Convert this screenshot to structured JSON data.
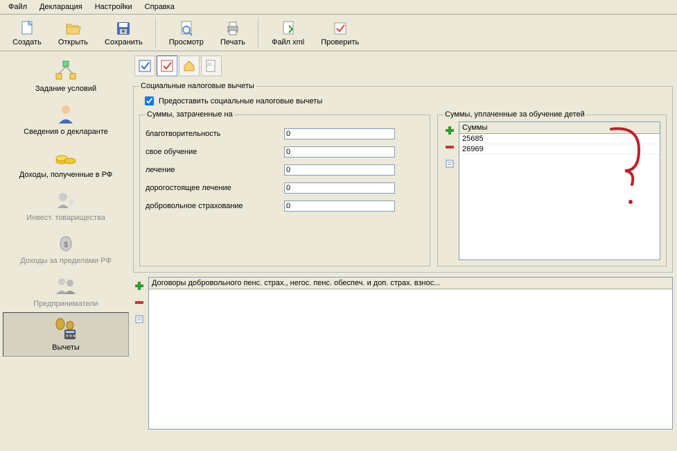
{
  "menubar": [
    "Файл",
    "Декларация",
    "Настройки",
    "Справка"
  ],
  "toolbar": [
    {
      "label": "Создать",
      "icon": "new"
    },
    {
      "label": "Открыть",
      "icon": "open"
    },
    {
      "label": "Сохранить",
      "icon": "save"
    },
    {
      "sep": true
    },
    {
      "label": "Просмотр",
      "icon": "preview"
    },
    {
      "label": "Печать",
      "icon": "print"
    },
    {
      "sep": true
    },
    {
      "label": "Файл xml",
      "icon": "xml"
    },
    {
      "label": "Проверить",
      "icon": "check"
    }
  ],
  "sidebar": [
    {
      "label": "Задание условий",
      "icon": "conditions",
      "enabled": true
    },
    {
      "label": "Сведения о декларанте",
      "icon": "declarant",
      "enabled": true
    },
    {
      "label": "Доходы, полученные в РФ",
      "icon": "income-rf",
      "enabled": true
    },
    {
      "label": "Инвест. товарищества",
      "icon": "invest",
      "enabled": false
    },
    {
      "label": "Доходы за пределами РФ",
      "icon": "income-abroad",
      "enabled": false
    },
    {
      "label": "Предприниматели",
      "icon": "entrepreneurs",
      "enabled": false
    },
    {
      "label": "Вычеты",
      "icon": "deductions",
      "enabled": true,
      "active": true
    }
  ],
  "section": {
    "title": "Социальные налоговые вычеты",
    "checkbox_label": "Предоставить социальные налоговые вычеты",
    "checkbox_checked": true,
    "sums": {
      "title": "Суммы, затраченные на",
      "fields": [
        {
          "label": "благотворительность",
          "value": "0"
        },
        {
          "label": "свое обучение",
          "value": "0"
        },
        {
          "label": "лечение",
          "value": "0"
        },
        {
          "label": "дорогостоящее лечение",
          "value": "0"
        },
        {
          "label": "добровольное страхование",
          "value": "0"
        }
      ]
    },
    "children": {
      "title": "Суммы, уплаченные за обучение детей",
      "header": "Суммы",
      "rows": [
        "25685",
        "26969"
      ]
    },
    "contracts": {
      "header": "Договоры добровольного пенс. страх., негос. пенс. обеспеч. и доп. страх. взнос..."
    }
  }
}
